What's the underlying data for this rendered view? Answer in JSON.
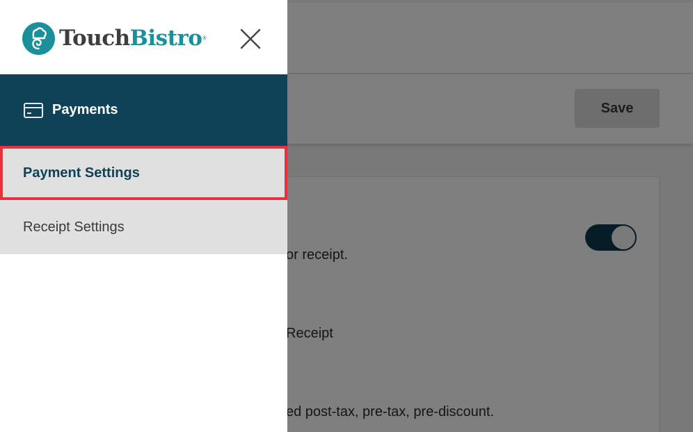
{
  "background": {
    "save_label": "Save",
    "text_line_1": "or receipt.",
    "text_line_2": "Receipt",
    "text_line_3": "ed post-tax, pre-tax, pre-discount.",
    "toggle_state": "on"
  },
  "drawer": {
    "brand_part_1": "Touch",
    "brand_part_2": "Bistro",
    "brand_tm": "®",
    "section": {
      "label": "Payments",
      "icon": "credit-card-icon"
    },
    "items": [
      {
        "label": "Payment Settings",
        "selected": true
      },
      {
        "label": "Receipt Settings",
        "selected": false
      }
    ]
  },
  "colors": {
    "brand_teal": "#1b8f9a",
    "section_bg": "#0f4157",
    "highlight_border": "#e8313b",
    "toggle_on": "#0d3b4f"
  }
}
